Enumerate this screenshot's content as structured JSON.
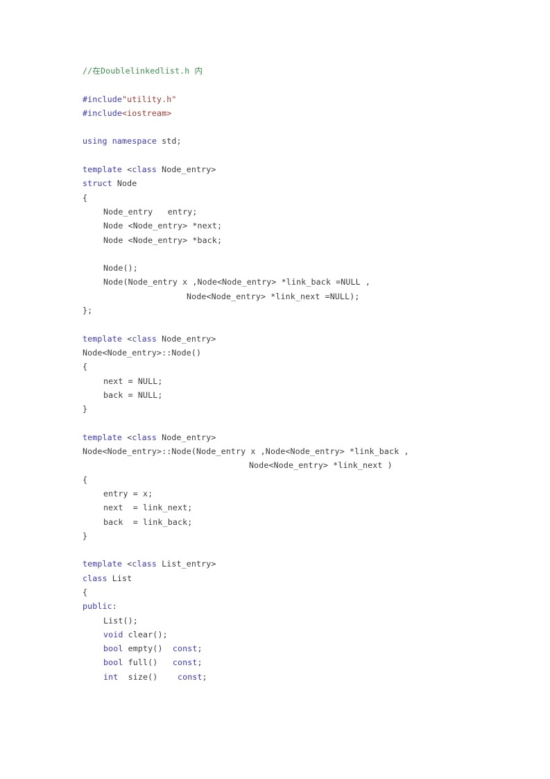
{
  "document": {
    "kind": "source-code-listing",
    "language": "C++",
    "background_color": "#ffffff",
    "colors": {
      "comment": "#3f8f4f",
      "keyword": "#3b38c4",
      "preprocessor": "#3b38c4",
      "string": "#a33a36",
      "include_target": "#a33a36",
      "plain_text": "#3b3b3b"
    },
    "lines": [
      {
        "indent": 0,
        "tokens": [
          {
            "t": "cmt",
            "s": "//在Doublelinkedlist.h 内"
          }
        ]
      },
      {
        "indent": 0,
        "tokens": []
      },
      {
        "indent": 0,
        "tokens": [
          {
            "t": "pre",
            "s": "#include"
          },
          {
            "t": "str",
            "s": "\"utility.h\""
          }
        ]
      },
      {
        "indent": 0,
        "tokens": [
          {
            "t": "pre",
            "s": "#include"
          },
          {
            "t": "inc",
            "s": "<iostream>"
          }
        ]
      },
      {
        "indent": 0,
        "tokens": []
      },
      {
        "indent": 0,
        "tokens": [
          {
            "t": "kw",
            "s": "using namespace"
          },
          {
            "t": "plain",
            "s": " std;"
          }
        ]
      },
      {
        "indent": 0,
        "tokens": []
      },
      {
        "indent": 0,
        "tokens": [
          {
            "t": "kw",
            "s": "template"
          },
          {
            "t": "plain",
            "s": " "
          },
          {
            "t": "punct",
            "s": "<"
          },
          {
            "t": "kw",
            "s": "class"
          },
          {
            "t": "plain",
            "s": " Node_entry"
          },
          {
            "t": "punct",
            "s": ">"
          }
        ]
      },
      {
        "indent": 0,
        "tokens": [
          {
            "t": "kw",
            "s": "struct"
          },
          {
            "t": "plain",
            "s": " Node"
          }
        ]
      },
      {
        "indent": 0,
        "tokens": [
          {
            "t": "plain",
            "s": "{"
          }
        ]
      },
      {
        "indent": 1,
        "tokens": [
          {
            "t": "plain",
            "s": "Node_entry   entry;"
          }
        ]
      },
      {
        "indent": 1,
        "tokens": [
          {
            "t": "plain",
            "s": "Node <Node_entry> *next;"
          }
        ]
      },
      {
        "indent": 1,
        "tokens": [
          {
            "t": "plain",
            "s": "Node <Node_entry> *back;"
          }
        ]
      },
      {
        "indent": 0,
        "tokens": []
      },
      {
        "indent": 1,
        "tokens": [
          {
            "t": "plain",
            "s": "Node();"
          }
        ]
      },
      {
        "indent": 1,
        "tokens": [
          {
            "t": "plain",
            "s": "Node(Node_entry x ,Node<Node_entry> *link_back =NULL ,"
          }
        ]
      },
      {
        "indent": 0,
        "pad": 150,
        "tokens": [
          {
            "t": "plain",
            "s": "Node<Node_entry> *link_next =NULL);"
          }
        ]
      },
      {
        "indent": 0,
        "tokens": [
          {
            "t": "plain",
            "s": "};"
          }
        ]
      },
      {
        "indent": 0,
        "tokens": []
      },
      {
        "indent": 0,
        "tokens": [
          {
            "t": "kw",
            "s": "template"
          },
          {
            "t": "plain",
            "s": " "
          },
          {
            "t": "punct",
            "s": "<"
          },
          {
            "t": "kw",
            "s": "class"
          },
          {
            "t": "plain",
            "s": " Node_entry"
          },
          {
            "t": "punct",
            "s": ">"
          }
        ]
      },
      {
        "indent": 0,
        "tokens": [
          {
            "t": "plain",
            "s": "Node<Node_entry>::Node()"
          }
        ]
      },
      {
        "indent": 0,
        "tokens": [
          {
            "t": "plain",
            "s": "{"
          }
        ]
      },
      {
        "indent": 1,
        "tokens": [
          {
            "t": "plain",
            "s": "next = NULL;"
          }
        ]
      },
      {
        "indent": 1,
        "tokens": [
          {
            "t": "plain",
            "s": "back = NULL;"
          }
        ]
      },
      {
        "indent": 0,
        "tokens": [
          {
            "t": "plain",
            "s": "}"
          }
        ]
      },
      {
        "indent": 0,
        "tokens": []
      },
      {
        "indent": 0,
        "tokens": [
          {
            "t": "kw",
            "s": "template"
          },
          {
            "t": "plain",
            "s": " "
          },
          {
            "t": "punct",
            "s": "<"
          },
          {
            "t": "kw",
            "s": "class"
          },
          {
            "t": "plain",
            "s": " Node_entry"
          },
          {
            "t": "punct",
            "s": ">"
          }
        ]
      },
      {
        "indent": 0,
        "tokens": [
          {
            "t": "plain",
            "s": "Node<Node_entry>::Node(Node_entry x ,Node<Node_entry> *link_back ,"
          }
        ]
      },
      {
        "indent": 0,
        "pad": 240,
        "tokens": [
          {
            "t": "plain",
            "s": "Node<Node_entry> *link_next )"
          }
        ]
      },
      {
        "indent": 0,
        "tokens": [
          {
            "t": "plain",
            "s": "{"
          }
        ]
      },
      {
        "indent": 1,
        "tokens": [
          {
            "t": "plain",
            "s": "entry = x;"
          }
        ]
      },
      {
        "indent": 1,
        "tokens": [
          {
            "t": "plain",
            "s": "next  = link_next;"
          }
        ]
      },
      {
        "indent": 1,
        "tokens": [
          {
            "t": "plain",
            "s": "back  = link_back;"
          }
        ]
      },
      {
        "indent": 0,
        "tokens": [
          {
            "t": "plain",
            "s": "}"
          }
        ]
      },
      {
        "indent": 0,
        "tokens": []
      },
      {
        "indent": 0,
        "tokens": [
          {
            "t": "kw",
            "s": "template"
          },
          {
            "t": "plain",
            "s": " "
          },
          {
            "t": "punct",
            "s": "<"
          },
          {
            "t": "kw",
            "s": "class"
          },
          {
            "t": "plain",
            "s": " List_entry"
          },
          {
            "t": "punct",
            "s": ">"
          }
        ]
      },
      {
        "indent": 0,
        "tokens": [
          {
            "t": "kw",
            "s": "class"
          },
          {
            "t": "plain",
            "s": " List"
          }
        ]
      },
      {
        "indent": 0,
        "tokens": [
          {
            "t": "plain",
            "s": "{"
          }
        ]
      },
      {
        "indent": 0,
        "tokens": [
          {
            "t": "kw",
            "s": "public:"
          }
        ]
      },
      {
        "indent": 1,
        "tokens": [
          {
            "t": "plain",
            "s": "List();"
          }
        ]
      },
      {
        "indent": 1,
        "tokens": [
          {
            "t": "kw",
            "s": "void"
          },
          {
            "t": "plain",
            "s": " clear();"
          }
        ]
      },
      {
        "indent": 1,
        "tokens": [
          {
            "t": "kw",
            "s": "bool"
          },
          {
            "t": "plain",
            "s": " empty()  "
          },
          {
            "t": "kw",
            "s": "const"
          },
          {
            "t": "plain",
            "s": ";"
          }
        ]
      },
      {
        "indent": 1,
        "tokens": [
          {
            "t": "kw",
            "s": "bool"
          },
          {
            "t": "plain",
            "s": " full()   "
          },
          {
            "t": "kw",
            "s": "const"
          },
          {
            "t": "plain",
            "s": ";"
          }
        ]
      },
      {
        "indent": 1,
        "tokens": [
          {
            "t": "kw",
            "s": "int"
          },
          {
            "t": "plain",
            "s": "  size()    "
          },
          {
            "t": "kw",
            "s": "const"
          },
          {
            "t": "plain",
            "s": ";"
          }
        ]
      }
    ]
  }
}
